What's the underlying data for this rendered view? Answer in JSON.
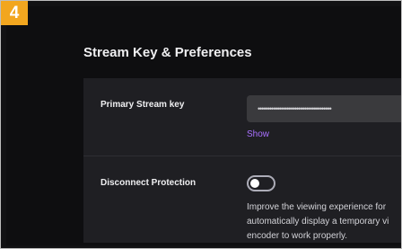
{
  "step_badge": "4",
  "page_title": "Stream Key & Preferences",
  "primary_stream_key": {
    "label": "Primary Stream key",
    "masked_value": "••••••••••••••••••••••••••••••••••••••",
    "show_link": "Show"
  },
  "disconnect_protection": {
    "label": "Disconnect Protection",
    "toggle_state": "off",
    "description_lines": [
      "Improve the viewing experience for",
      "automatically display a temporary vi",
      "encoder to work properly."
    ]
  },
  "colors": {
    "badge": "#f2a61f",
    "background": "#0e0e10",
    "card": "#1f1f23",
    "link": "#a970ff",
    "input": "#3a3a3d"
  }
}
